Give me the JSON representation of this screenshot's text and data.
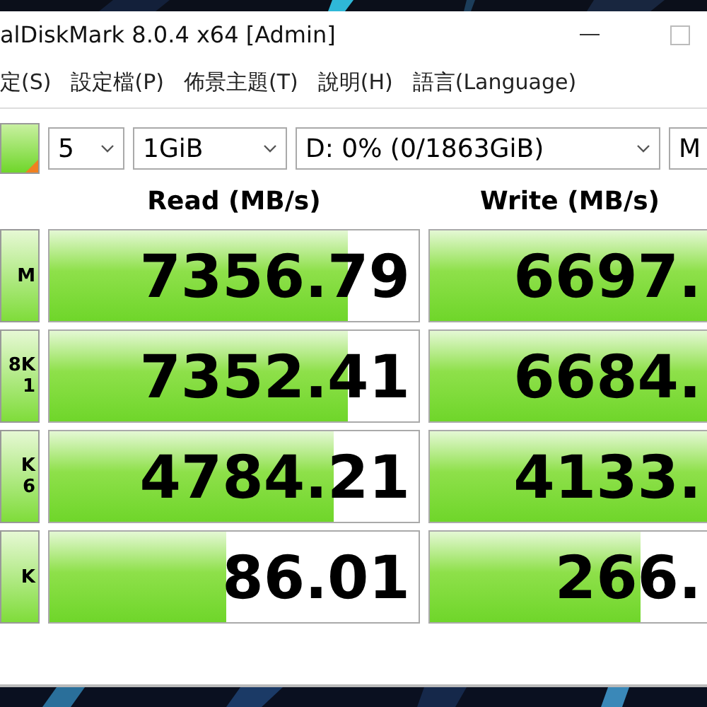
{
  "window": {
    "title": "alDiskMark 8.0.4 x64 [Admin]"
  },
  "menu": [
    "定(S)",
    "設定檔(P)",
    "佈景主題(T)",
    "說明(H)",
    "語言(Language)"
  ],
  "toolbar": {
    "count": "5",
    "size": "1GiB",
    "drive": "D: 0% (0/1863GiB)",
    "unit": "M"
  },
  "headers": {
    "read": "Read (MB/s)",
    "write": "Write (MB/s)"
  },
  "tests": [
    {
      "label": [
        "M"
      ],
      "read": {
        "value": "7356.79",
        "level": 0.81
      },
      "write": {
        "value": "6697.",
        "level": 1
      }
    },
    {
      "label": [
        "8K",
        "1"
      ],
      "read": {
        "value": "7352.41",
        "level": 0.81
      },
      "write": {
        "value": "6684.",
        "level": 1
      }
    },
    {
      "label": [
        "K",
        "6"
      ],
      "read": {
        "value": "4784.21",
        "level": 0.77
      },
      "write": {
        "value": "4133.",
        "level": 1
      }
    },
    {
      "label": [
        "K"
      ],
      "read": {
        "value": "86.01",
        "level": 0.48
      },
      "write": {
        "value": "266.",
        "level": 0.75
      }
    }
  ]
}
